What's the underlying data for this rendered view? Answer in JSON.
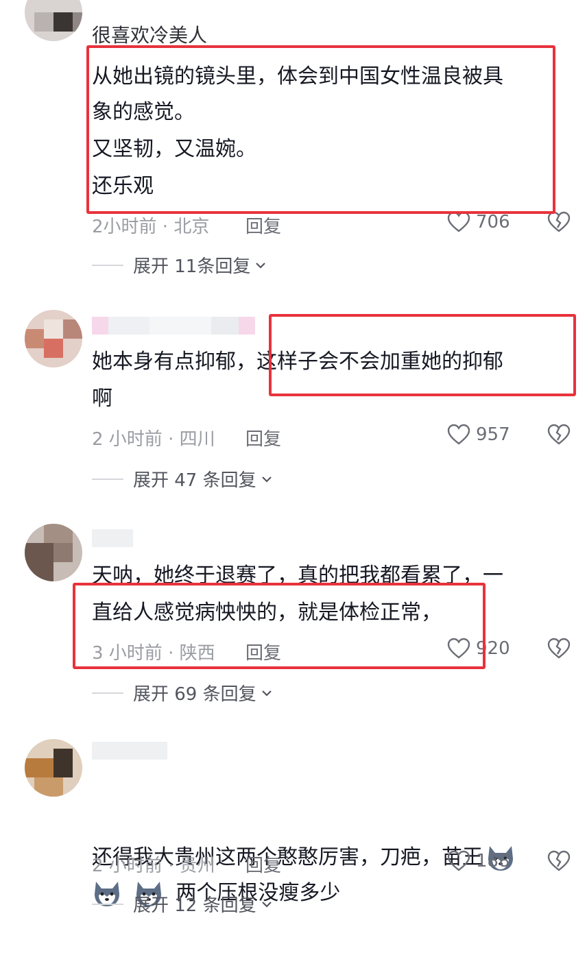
{
  "comments": [
    {
      "username": "很喜欢冷美人",
      "lines": [
        "从她出镜的镜头里，体会到中国女性温良被具",
        "象的感觉。",
        "又坚韧，又温婉。",
        "还乐观"
      ],
      "time": "2小时前 · 北京",
      "reply": "回复",
      "likes": "706",
      "expand": "展开 11条回复"
    },
    {
      "username": "",
      "lines": [
        "她本身有点抑郁，这样子会不会加重她的抑郁",
        "啊"
      ],
      "time": "2 小时前 · 四川",
      "reply": "回复",
      "likes": "957",
      "expand": "展开 47 条回复"
    },
    {
      "username": "",
      "lines": [
        "天呐，她终于退赛了，真的把我都看累了，一",
        "直给人感觉病怏怏的，就是体检正常，"
      ],
      "time": "3 小时前 · 陕西",
      "reply": "回复",
      "likes": "920",
      "expand": "展开 69 条回复"
    },
    {
      "username": "",
      "lines": [
        "还得我大贵州这两个憨憨厉害，刀疤，苗王",
        "两个压根没瘦多少"
      ],
      "time": "2 小时前 · 贵州",
      "reply": "回复",
      "likes": "188",
      "expand": "展开 12 条回复"
    }
  ],
  "icons": {
    "like": "heart-outline-icon",
    "dislike": "broken-heart-icon",
    "expand": "chevron-down-icon",
    "emoji": "husky-dog-emoji-icon"
  },
  "colors": {
    "highlight_box": "#e8323c",
    "meta_text": "#9a9ca3",
    "body_text": "#161823"
  }
}
